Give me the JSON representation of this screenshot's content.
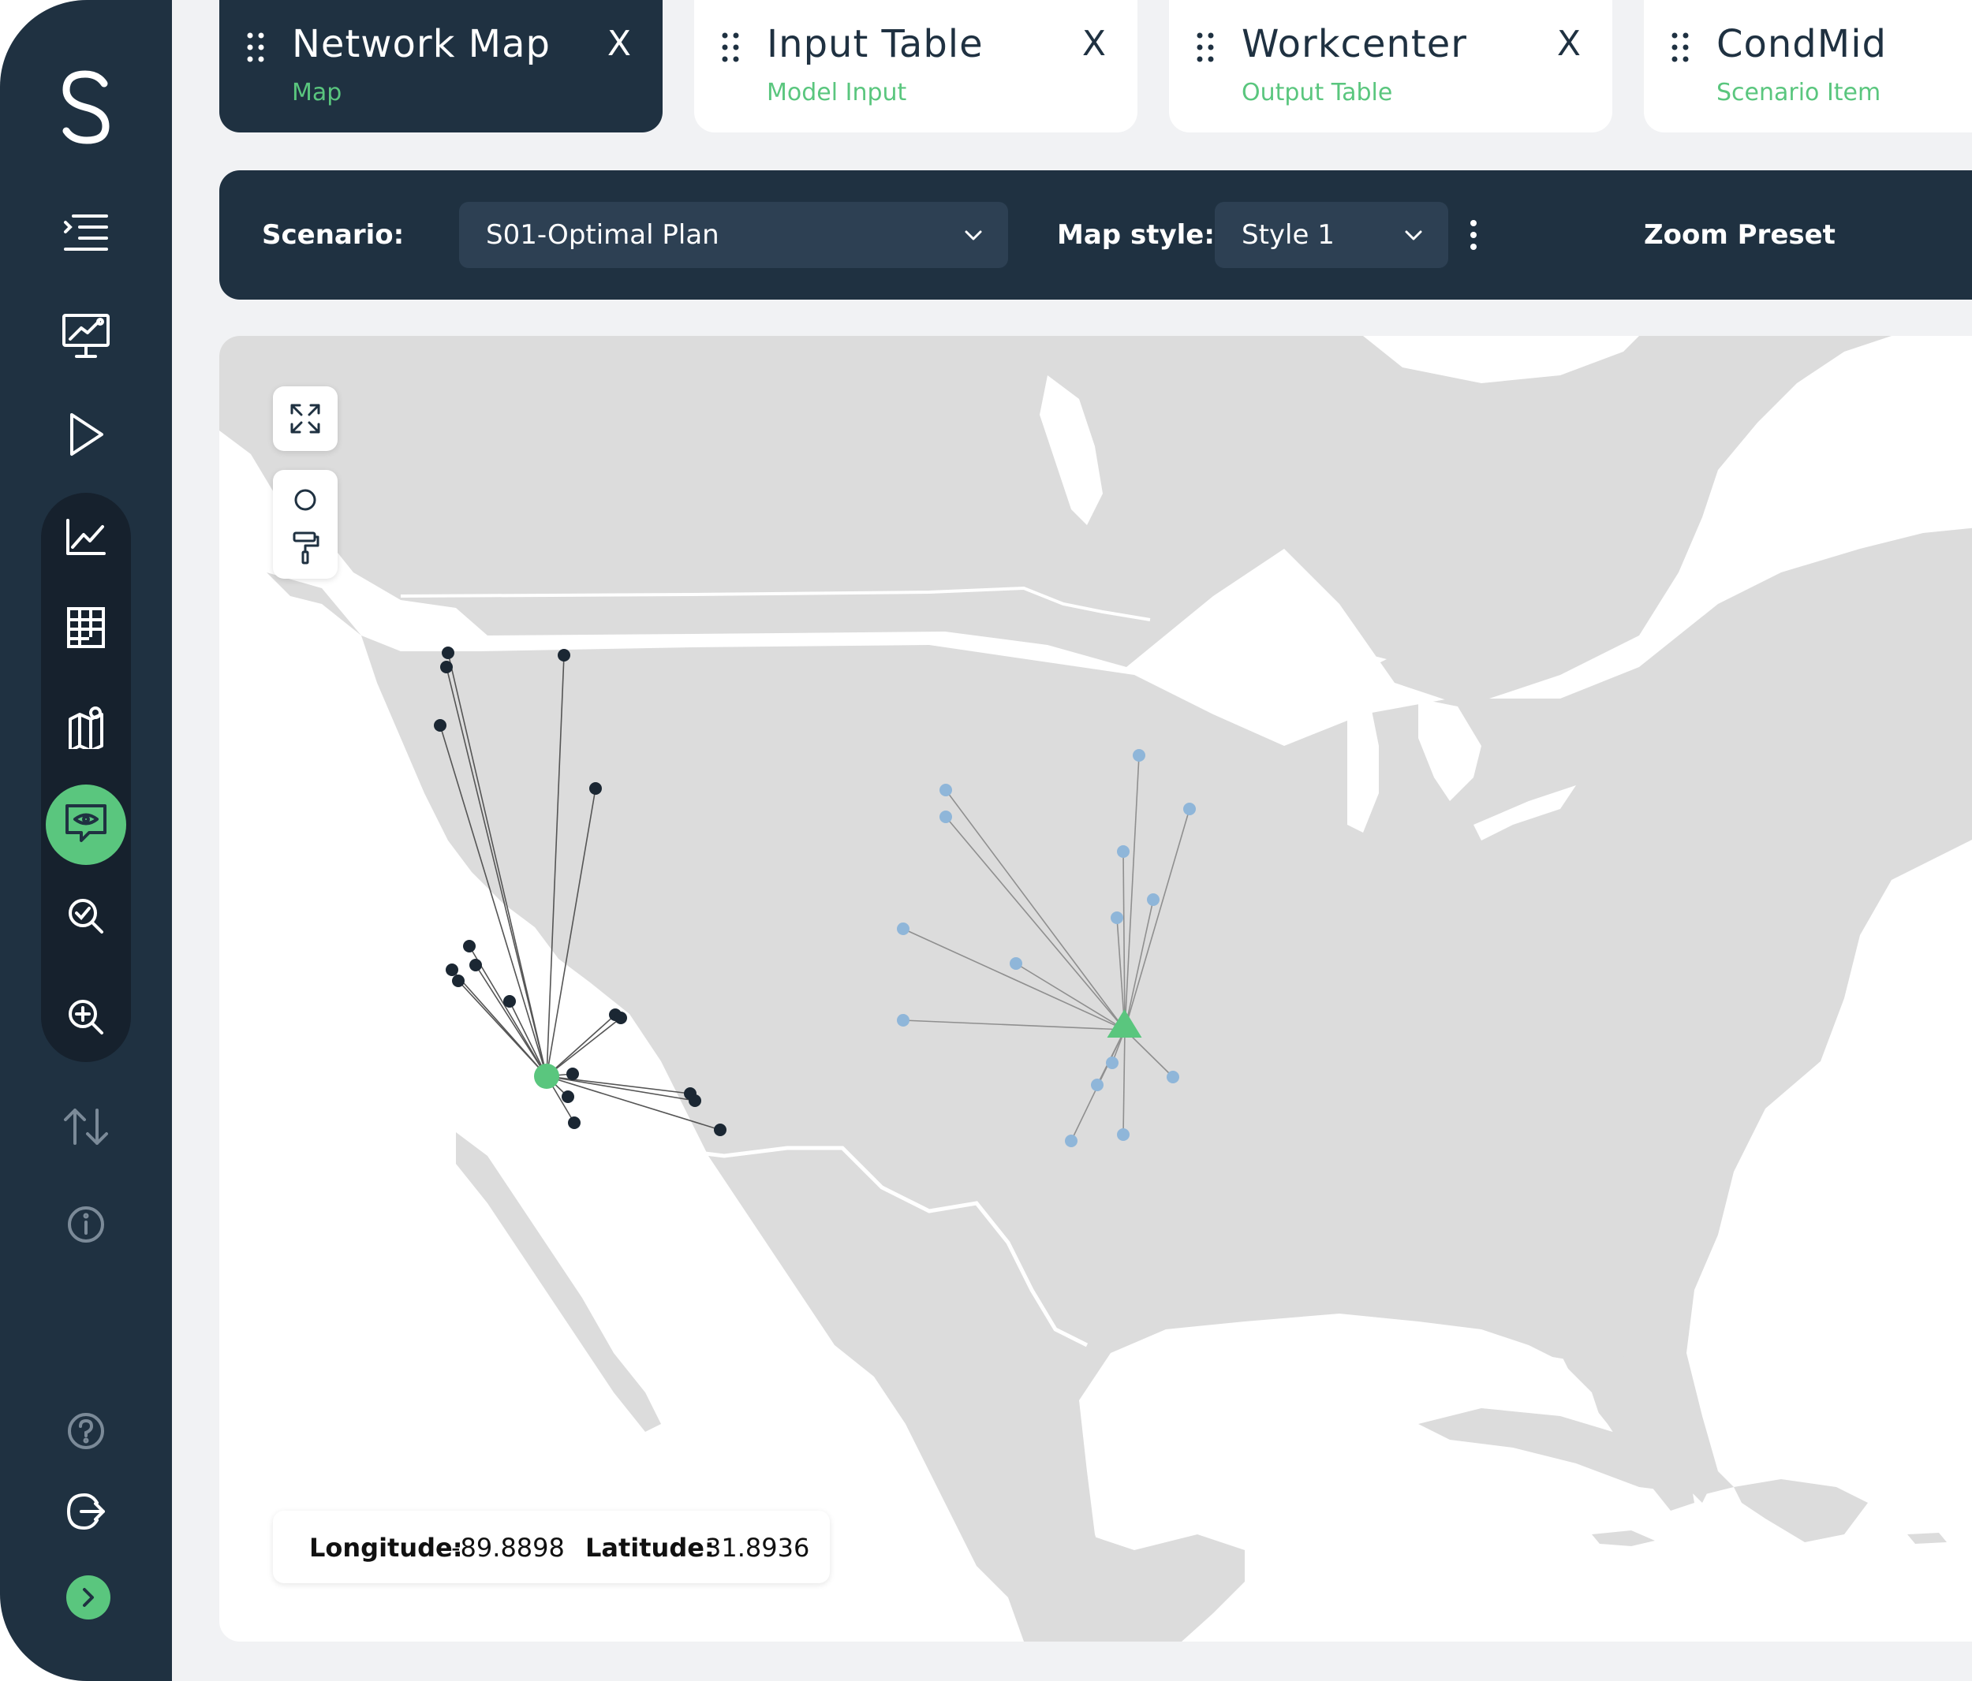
{
  "tabs": [
    {
      "title": "Network Map",
      "subtitle": "Map",
      "close": "X",
      "active": true
    },
    {
      "title": "Input Table",
      "subtitle": "Model Input",
      "close": "X",
      "active": false
    },
    {
      "title": "Workcenter",
      "subtitle": "Output Table",
      "close": "X",
      "active": false
    },
    {
      "title": "CondMid",
      "subtitle": "Scenario Item",
      "close": "",
      "active": false
    }
  ],
  "toolbar": {
    "scenario_label": "Scenario:",
    "help_glyph": "?",
    "scenario_value": "S01-Optimal Plan",
    "map_style_label": "Map style:",
    "map_style_value": "Style 1",
    "zoom_preset_label": "Zoom Preset"
  },
  "coords": {
    "longitude_label": "Longitude:",
    "longitude_value": "-89.8898",
    "latitude_label": "Latitude:",
    "latitude_value": "31.8936"
  },
  "sidebar_icons": [
    "logo-icon",
    "menu-list-icon",
    "presentation-chart-icon",
    "play-icon",
    "line-chart-icon",
    "table-edit-icon",
    "map-pin-icon",
    "view-monitor-icon",
    "search-check-icon",
    "search-plus-icon",
    "sort-arrows-icon",
    "info-icon",
    "help-icon",
    "logout-icon",
    "chevron-right-icon"
  ],
  "colors": {
    "sidebar": "#1f3141",
    "accent": "#5ac67e",
    "land": "#dcdcdc",
    "west_customers": "#1b2733",
    "central_customers": "#8fb6d9"
  }
}
